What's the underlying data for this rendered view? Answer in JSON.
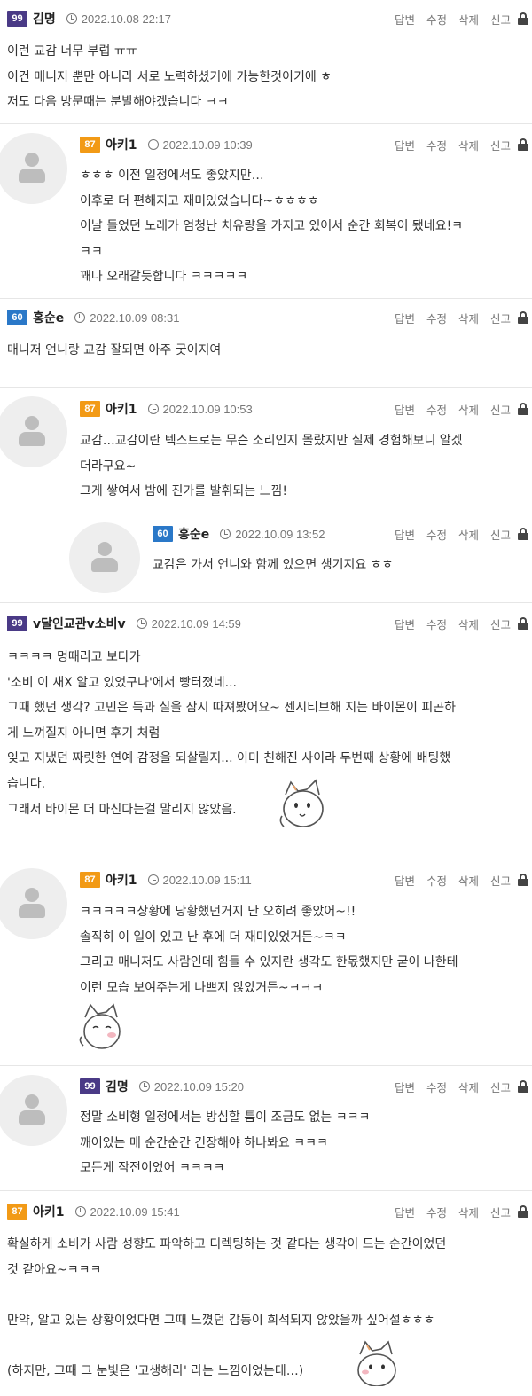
{
  "actions": {
    "reply": "답변",
    "edit": "수정",
    "delete": "삭제",
    "report": "신고"
  },
  "comments": [
    {
      "level": "99",
      "nick": "김명",
      "date": "2022.10.08 22:17",
      "lines": [
        "이런 교감 너무 부럽 ㅠㅠ",
        "이건 매니저 뿐만 아니라 서로 노력하셨기에 가능한것이기에 ㅎ",
        "저도 다음 방문때는 분발해야겠습니다 ㅋㅋ"
      ]
    },
    {
      "level": "87",
      "nick": "아키1",
      "date": "2022.10.09 10:39",
      "lines": [
        "ㅎㅎㅎ 이전 일정에서도 좋았지만…",
        "이후로 더 편해지고 재미있었습니다~ㅎㅎㅎㅎ",
        "이날 들었던 노래가 엄청난 치유량을 가지고 있어서 순간 회복이 됐네요!ㅋ",
        "ㅋㅋ",
        "꽤나 오래갈듯합니다 ㅋㅋㅋㅋㅋ"
      ]
    },
    {
      "level": "60",
      "nick": "홍순e",
      "date": "2022.10.09 08:31",
      "lines": [
        "매니저 언니랑 교감 잘되면 아주 굿이지여"
      ]
    },
    {
      "level": "87",
      "nick": "아키1",
      "date": "2022.10.09 10:53",
      "lines": [
        "교감…교감이란 텍스트로는 무슨 소리인지 몰랐지만 실제 경험해보니 알겠",
        "더라구요~",
        "그게 쌓여서 밤에 진가를 발휘되는 느낌!"
      ]
    },
    {
      "level": "60",
      "nick": "홍순e",
      "date": "2022.10.09 13:52",
      "lines": [
        "교감은 가서 언니와 함께 있으면 생기지요 ㅎㅎ"
      ]
    },
    {
      "level": "99",
      "nick": "v달인교관v소비v",
      "date": "2022.10.09 14:59",
      "lines": [
        "ㅋㅋㅋㅋ 멍때리고 보다가",
        "'소비 이 새X 알고 있었구나'에서 빵터졌네...",
        "그때 했던 생각? 고민은 득과 실을 잠시 따져봤어요~ 센시티브해 지는 바이몬이 피곤하",
        "게 느껴질지 아니면 후기 처럼",
        "잊고 지냈던 짜릿한 연예 감정을 되살릴지... 이미 친해진 사이라 두번째 상황에 배팅했",
        "습니다.",
        "그래서 바이몬 더 마신다는걸 말리지 않았음."
      ]
    },
    {
      "level": "87",
      "nick": "아키1",
      "date": "2022.10.09 15:11",
      "lines": [
        "ㅋㅋㅋㅋㅋ상황에 당황했던거지 난 오히려 좋았어~!!",
        "솔직히 이 일이 있고 난 후에 더 재미있었거든~ㅋㅋ",
        "그리고 매니저도 사람인데 힘들 수 있지란 생각도 한몫했지만 굳이 나한테",
        "이런 모습 보여주는게 나쁘지 않았거든~ㅋㅋㅋ"
      ]
    },
    {
      "level": "99",
      "nick": "김명",
      "date": "2022.10.09 15:20",
      "lines": [
        "정말 소비형 일정에서는 방심할 틈이 조금도 없는 ㅋㅋㅋ",
        "깨어있는 매 순간순간 긴장해야 하나봐요 ㅋㅋㅋ",
        "모든게 작전이었어 ㅋㅋㅋㅋ"
      ]
    },
    {
      "level": "87",
      "nick": "아키1",
      "date": "2022.10.09 15:41",
      "lines": [
        "확실하게 소비가 사람 성향도 파악하고 디렉팅하는 것 같다는 생각이 드는 순간이었던",
        "것 같아요~ㅋㅋㅋ",
        "",
        "만약, 알고 있는 상황이었다면 그때 느꼈던 감동이 희석되지 않았을까 싶어설ㅎㅎㅎ",
        "",
        "(하지만, 그때 그 눈빛은 '고생해라' 라는 느낌이었는데…)"
      ]
    }
  ],
  "colors": {
    "lv99": "#4a3a86",
    "lv87": "#f29a16",
    "lv60": "#2a78c8"
  },
  "icons": [
    "clock-icon",
    "lock-icon",
    "avatar-placeholder-icon",
    "cat-sticker"
  ]
}
